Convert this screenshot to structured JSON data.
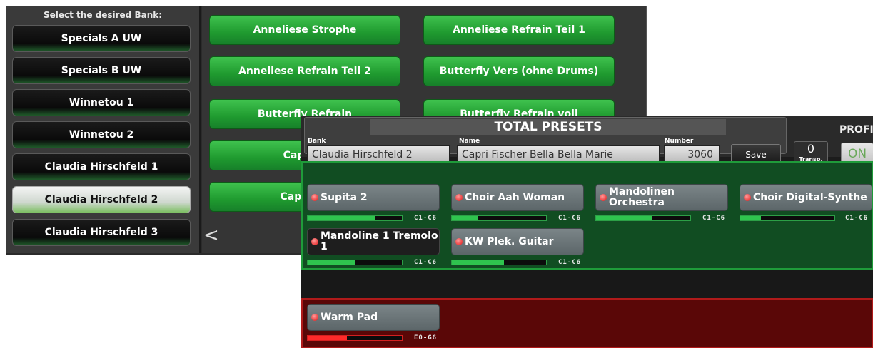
{
  "bank_window": {
    "header": "Select the desired Bank:",
    "banks": [
      {
        "label": "Specials A UW",
        "selected": false
      },
      {
        "label": "Specials B UW",
        "selected": false
      },
      {
        "label": "Winnetou 1",
        "selected": false
      },
      {
        "label": "Winnetou 2",
        "selected": false
      },
      {
        "label": "Claudia Hirschfeld 1",
        "selected": false
      },
      {
        "label": "Claudia Hirschfeld 2",
        "selected": true
      },
      {
        "label": "Claudia Hirschfeld 3",
        "selected": false
      }
    ],
    "presets": [
      "Anneliese Strophe",
      "Anneliese Refrain Teil 1",
      "Anneliese Refrain Teil 2",
      "Butterfly Vers (ohne Drums)",
      "Butterfly Refrain",
      "Butterfly Refrain voll",
      "Capri Fi",
      "Capri Fis"
    ],
    "back_icon": "<"
  },
  "total_presets": {
    "title": "TOTAL PRESETS",
    "bank_label": "Bank",
    "bank_value": "Claudia Hirschfeld 2",
    "name_label": "Name",
    "name_value": "Capri Fischer Bella Bella Marie",
    "number_label": "Number",
    "number_value": "3060",
    "save_label": "Save",
    "transp_value": "0",
    "transp_label": "Transp.",
    "profi_label": "PROFI",
    "on_label": "ON"
  },
  "upper_voices": [
    {
      "name": "Supita 2",
      "range": "C1-C6",
      "level": 0.72,
      "dark": false
    },
    {
      "name": "Choir Aah Woman",
      "range": "C1-C6",
      "level": 0.28,
      "dark": false
    },
    {
      "name": "Mandolinen Orchestra",
      "range": "C1-C6",
      "level": 0.6,
      "dark": false
    },
    {
      "name": "Choir Digital-Synthe",
      "range": "C1-C6",
      "level": 0.22,
      "dark": false
    },
    {
      "name": "Mandoline 1 Tremolo 1",
      "range": "C1-C6",
      "level": 0.5,
      "dark": true
    },
    {
      "name": "KW Plek. Guitar",
      "range": "C1-C6",
      "level": 0.55,
      "dark": false
    }
  ],
  "lower_voices": [
    {
      "name": "Warm Pad",
      "range": "E0-G6",
      "level": 0.42
    }
  ],
  "colors": {
    "upper_bg": "#114d22",
    "lower_bg": "#5a0707",
    "preset_green": "#23a334",
    "led_red": "#e01010"
  }
}
